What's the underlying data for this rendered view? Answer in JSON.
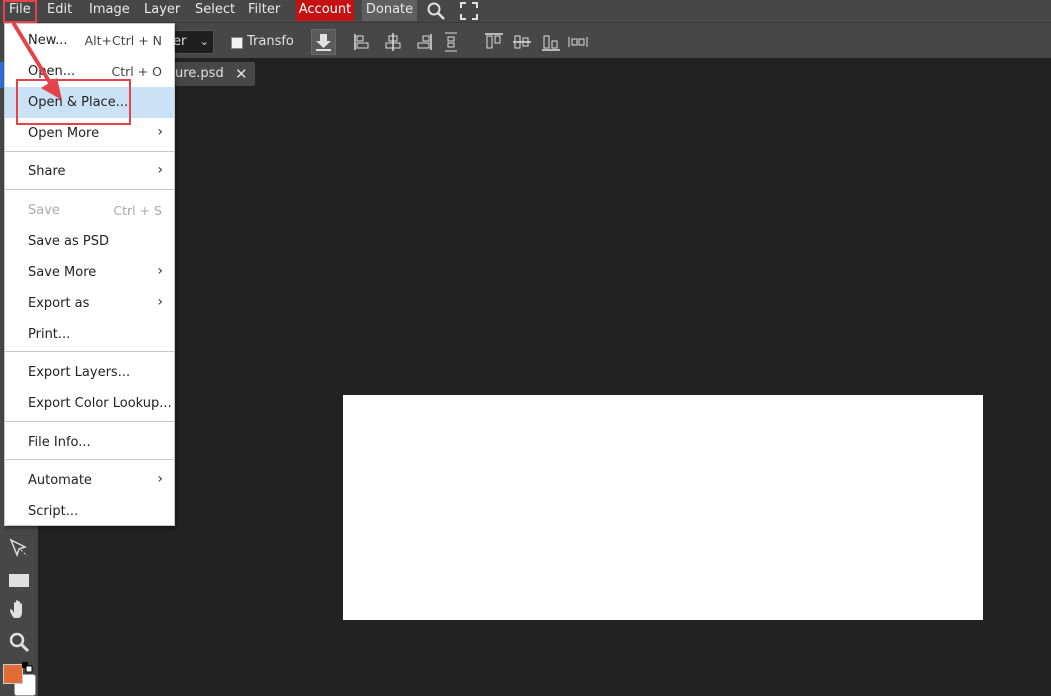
{
  "menubar": {
    "items": [
      "File",
      "Edit",
      "Image",
      "Layer",
      "Select",
      "Filter"
    ],
    "account_label": "Account",
    "donate_label": "Donate",
    "search_icon": "search-icon",
    "fullscreen_icon": "fullscreen-icon",
    "account_color": "#c41212"
  },
  "options": {
    "select_value": "er",
    "transform_label": "Transfo"
  },
  "tab": {
    "label": "ure.psd",
    "close_label": "✕"
  },
  "file_menu": {
    "items": [
      {
        "label": "New...",
        "shortcut": "Alt+Ctrl + N"
      },
      {
        "label": "Open...",
        "shortcut": "Ctrl + O"
      },
      {
        "label": "Open & Place..."
      },
      {
        "label": "Open More",
        "submenu": true
      },
      {
        "label": "Share",
        "submenu": true
      },
      {
        "label": "Save",
        "shortcut": "Ctrl + S",
        "disabled": true
      },
      {
        "label": "Save as PSD"
      },
      {
        "label": "Save More",
        "submenu": true
      },
      {
        "label": "Export as",
        "submenu": true
      },
      {
        "label": "Print..."
      },
      {
        "label": "Export Layers..."
      },
      {
        "label": "Export Color Lookup..."
      },
      {
        "label": "File Info..."
      },
      {
        "label": "Automate",
        "submenu": true
      },
      {
        "label": "Script..."
      }
    ],
    "submenu_arrow": "›",
    "highlight_color": "#cbe1f5"
  },
  "colors": {
    "foreground": "#e06d36",
    "background": "#ffffff",
    "annotation": "#e4434a"
  }
}
